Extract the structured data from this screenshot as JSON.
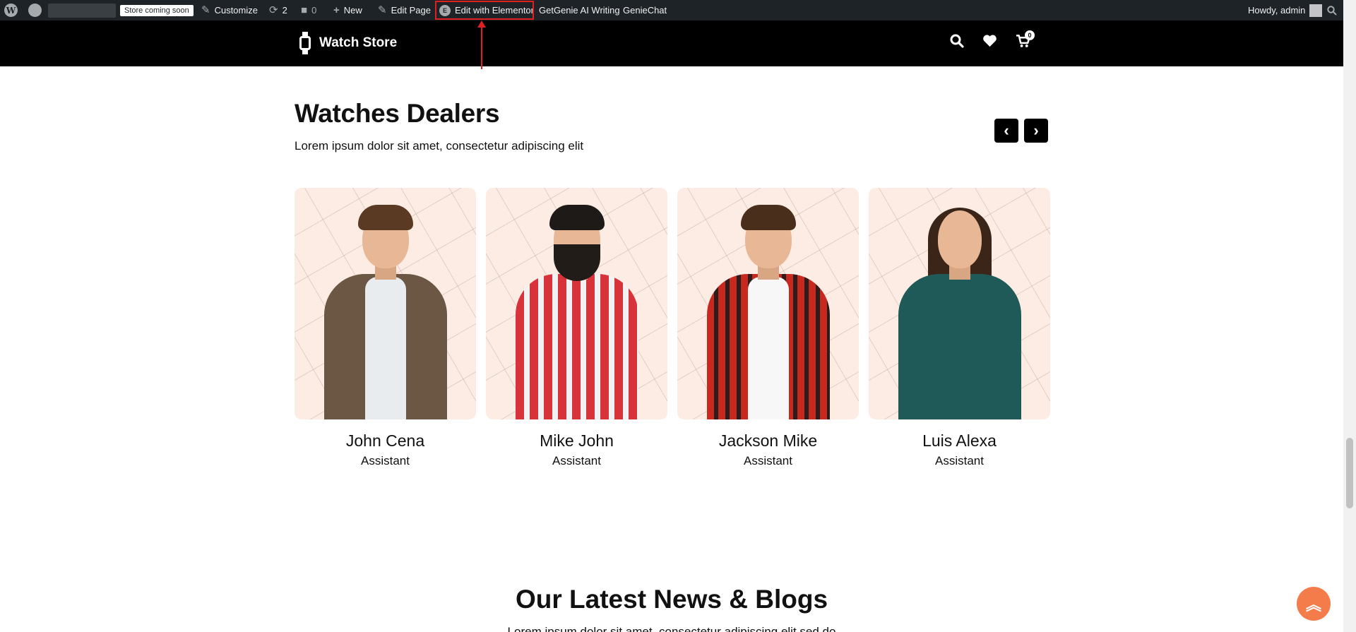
{
  "admin_bar": {
    "store_badge": "Store coming soon",
    "customize": "Customize",
    "updates_count": "2",
    "comments_count": "0",
    "new": "New",
    "edit_page": "Edit Page",
    "edit_elementor": "Edit with Elementor",
    "getgenie": "GetGenie AI Writing",
    "geniechat": "GenieChat",
    "howdy": "Howdy, admin"
  },
  "header": {
    "logo_text": "Watch Store",
    "cart_count": "0"
  },
  "dealers": {
    "title": "Watches Dealers",
    "subtitle": "Lorem ipsum dolor sit amet, consectetur adipiscing elit",
    "prev_glyph": "‹",
    "next_glyph": "›",
    "cards": [
      {
        "name": "John Cena",
        "role": "Assistant"
      },
      {
        "name": "Mike John",
        "role": "Assistant"
      },
      {
        "name": "Jackson Mike",
        "role": "Assistant"
      },
      {
        "name": "Luis Alexa",
        "role": "Assistant"
      }
    ]
  },
  "blogs": {
    "title": "Our Latest News & Blogs",
    "subtitle": "Lorem ipsum dolor sit amet, consectetur adipiscing elit sed do"
  },
  "colors": {
    "admin_bar": "#1d2327",
    "header": "#000000",
    "card_bg": "#fdece3",
    "accent": "#f47c4a",
    "highlight": "#e02020"
  },
  "icons": {
    "wordpress": "wordpress-icon",
    "dashboard": "dashboard-icon",
    "customize": "brush-icon",
    "updates": "refresh-icon",
    "comments": "comment-icon",
    "new": "plus-icon",
    "edit": "pencil-icon",
    "elementor": "elementor-icon",
    "search": "search-icon",
    "wishlist": "heart-icon",
    "cart": "cart-icon",
    "scroll_top": "double-chevron-up-icon"
  }
}
